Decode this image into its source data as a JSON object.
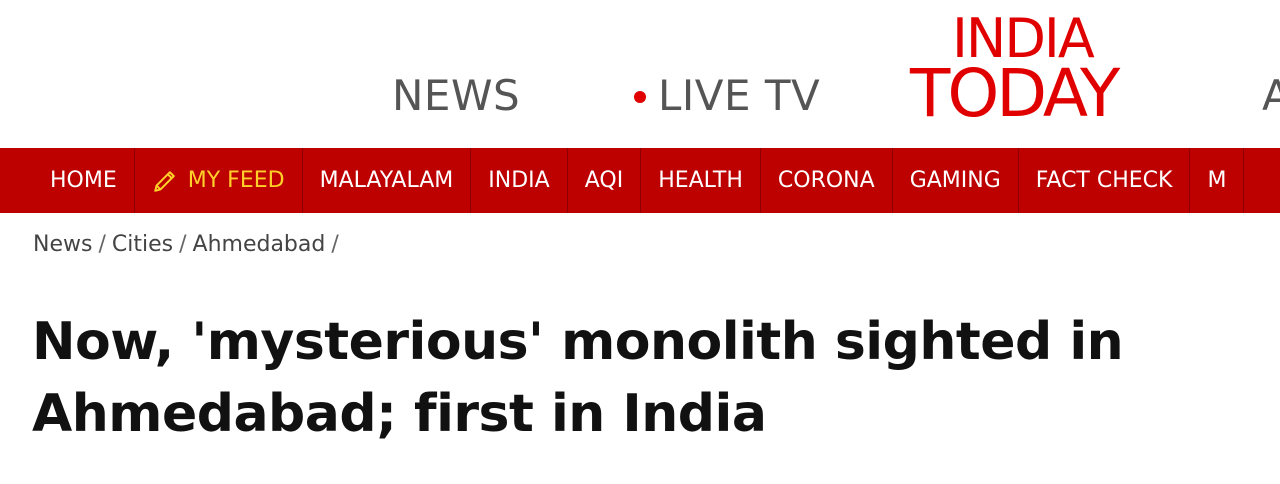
{
  "header": {
    "news_label": "NEWS",
    "live_label": "LIVE TV",
    "logo_line1": "INDIA",
    "logo_line2": "TODAY",
    "partial_item": "A"
  },
  "nav": {
    "items": [
      {
        "label": "HOME"
      },
      {
        "label": "MY FEED",
        "icon": "pencil-icon"
      },
      {
        "label": "MALAYALAM"
      },
      {
        "label": "INDIA"
      },
      {
        "label": "AQI"
      },
      {
        "label": "HEALTH"
      },
      {
        "label": "CORONA"
      },
      {
        "label": "GAMING"
      },
      {
        "label": "FACT CHECK"
      },
      {
        "label": "M"
      }
    ]
  },
  "breadcrumb": {
    "items": [
      "News",
      "Cities",
      "Ahmedabad"
    ],
    "separator": "/"
  },
  "article": {
    "headline": "Now, 'mysterious' monolith sighted in Ahmedabad; first in India"
  },
  "colors": {
    "brand_red": "#bd0000",
    "logo_red": "#e10000",
    "my_feed_yellow": "#ffd02a",
    "live_dot": "#e10000"
  }
}
